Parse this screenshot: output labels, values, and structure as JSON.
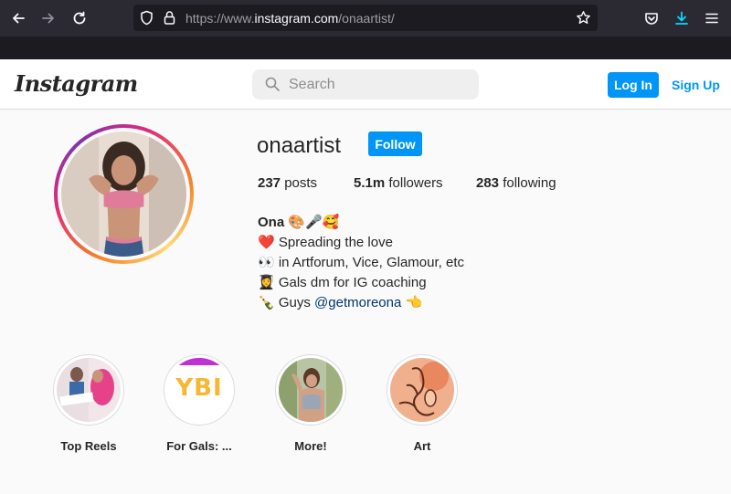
{
  "browser": {
    "url_prefix": "https://www.",
    "url_domain": "instagram.com",
    "url_path": "/onaartist/",
    "accent": "#2b2a33"
  },
  "header": {
    "logo_text": "Instagram",
    "search_placeholder": "Search",
    "login_label": "Log In",
    "signup_label": "Sign Up",
    "button_color": "#0095f6"
  },
  "profile": {
    "username": "onaartist",
    "follow_label": "Follow",
    "posts_count": "237",
    "posts_label": "posts",
    "followers_count": "5.1m",
    "followers_label": "followers",
    "following_count": "283",
    "following_label": "following",
    "bio": {
      "name": "Ona 🎨🎤🥰",
      "line1": "❤️ Spreading the love",
      "line2": "👀 in Artforum, Vice, Glamour, etc",
      "line3": "👩‍🎓 Gals dm for IG coaching",
      "line4_prefix": "🍾 Guys ",
      "line4_link": "@getmoreona",
      "line4_suffix": " 👈"
    }
  },
  "highlights": [
    {
      "label": "Top Reels"
    },
    {
      "label": "For Gals: ...",
      "art_text": "YBI"
    },
    {
      "label": "More!"
    },
    {
      "label": "Art"
    }
  ]
}
